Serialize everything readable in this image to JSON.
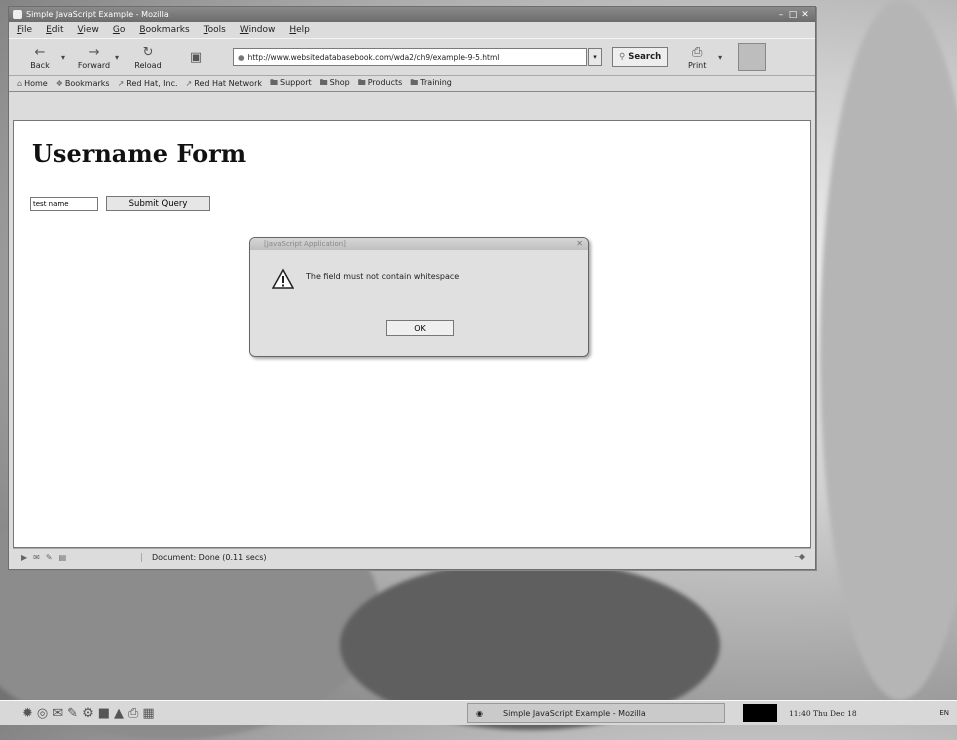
{
  "window": {
    "title": "Simple JavaScript Example - Mozilla",
    "controls": [
      "–",
      "□",
      "✕"
    ]
  },
  "menubar": [
    "File",
    "Edit",
    "View",
    "Go",
    "Bookmarks",
    "Tools",
    "Window",
    "Help"
  ],
  "toolbar": {
    "back_label": "Back",
    "forward_label": "Forward",
    "reload_label": "Reload",
    "url": "http://www.websitedatabasebook.com/wda2/ch9/example-9-5.html",
    "search_label": "Search",
    "print_label": "Print"
  },
  "bookmarks": [
    "Home",
    "Bookmarks",
    "Red Hat, Inc.",
    "Red Hat Network",
    "Support",
    "Shop",
    "Products",
    "Training"
  ],
  "page": {
    "heading": "Username Form",
    "input_value": "test name",
    "submit_label": "Submit Query"
  },
  "dialog": {
    "title": "[JavaScript Application]",
    "message": "The field must not contain whitespace",
    "ok_label": "OK"
  },
  "statusbar": {
    "text": "Document: Done (0.11 secs)"
  },
  "taskbar": {
    "task_label": "Simple JavaScript Example - Mozilla",
    "clock": "11:40 Thu Dec 18",
    "tray": "EN"
  },
  "colors": {
    "window_bg": "#dcdcdc",
    "titlebar": "#7a7a7a",
    "content_bg": "#ffffff"
  }
}
